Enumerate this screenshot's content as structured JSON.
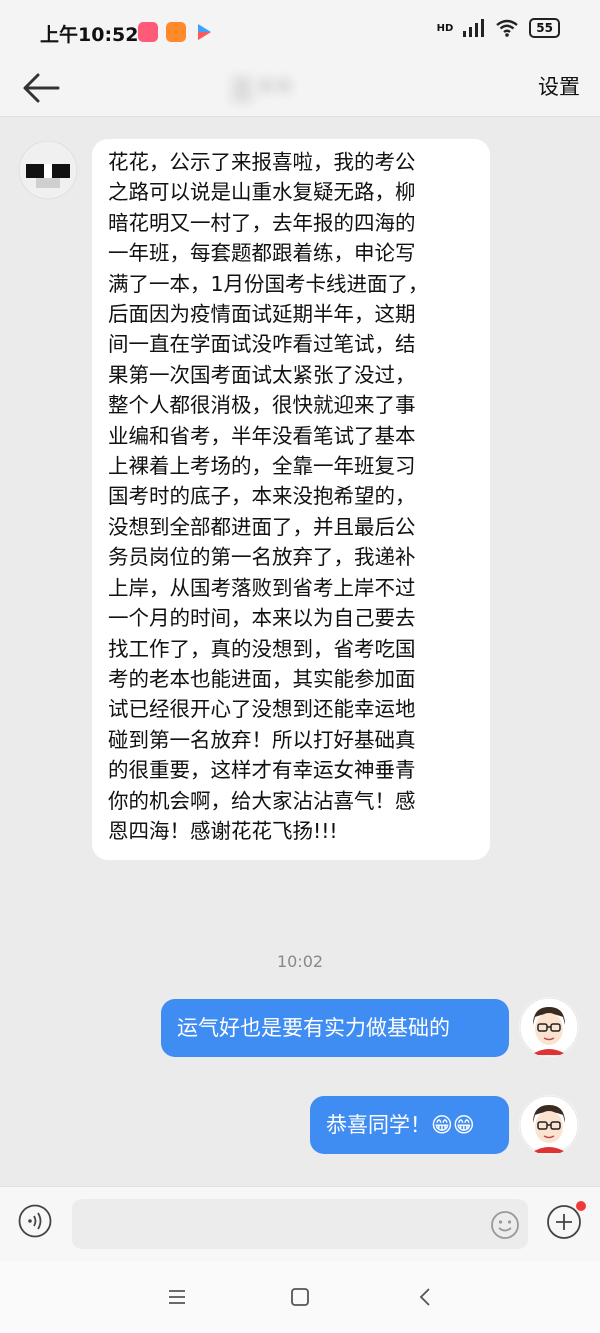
{
  "status_bar": {
    "time": "上午10:52",
    "network_label": "HD",
    "battery": "55"
  },
  "header": {
    "title": "三**",
    "settings_label": "设置",
    "back_icon": "back-arrow-icon"
  },
  "messages": {
    "incoming_text": "花花，公示了来报喜啦，我的考公\n之路可以说是山重水复疑无路，柳\n暗花明又一村了，去年报的四海的\n一年班，每套题都跟着练，申论写\n满了一本，1月份国考卡线进面了，\n后面因为疫情面试延期半年，这期\n间一直在学面试没咋看过笔试，结\n果第一次国考面试太紧张了没过，\n整个人都很消极，很快就迎来了事\n业编和省考，半年没看笔试了基本\n上裸着上考场的，全靠一年班复习\n国考时的底子，本来没抱希望的，\n没想到全部都进面了，并且最后公\n务员岗位的第一名放弃了，我递补\n上岸，从国考落败到省考上岸不过\n一个月的时间，本来以为自己要去\n找工作了，真的没想到，省考吃国\n考的老本也能进面，其实能参加面\n试已经很开心了没想到还能幸运地\n碰到第一名放弃！所以打好基础真\n的很重要，这样才有幸运女神垂青\n你的机会啊，给大家沾沾喜气！感\n恩四海！感谢花花飞扬!!!",
    "timestamp": "10:02",
    "outgoing_1": "运气好也是要有实力做基础的",
    "outgoing_2": "恭喜同学！😁😁"
  },
  "input_bar": {
    "placeholder": "",
    "value": ""
  },
  "colors": {
    "outgoing_bubble": "#3f8cf3",
    "incoming_bubble": "#ffffff",
    "background": "#ebebeb",
    "badge_dot": "#f03a3a"
  }
}
